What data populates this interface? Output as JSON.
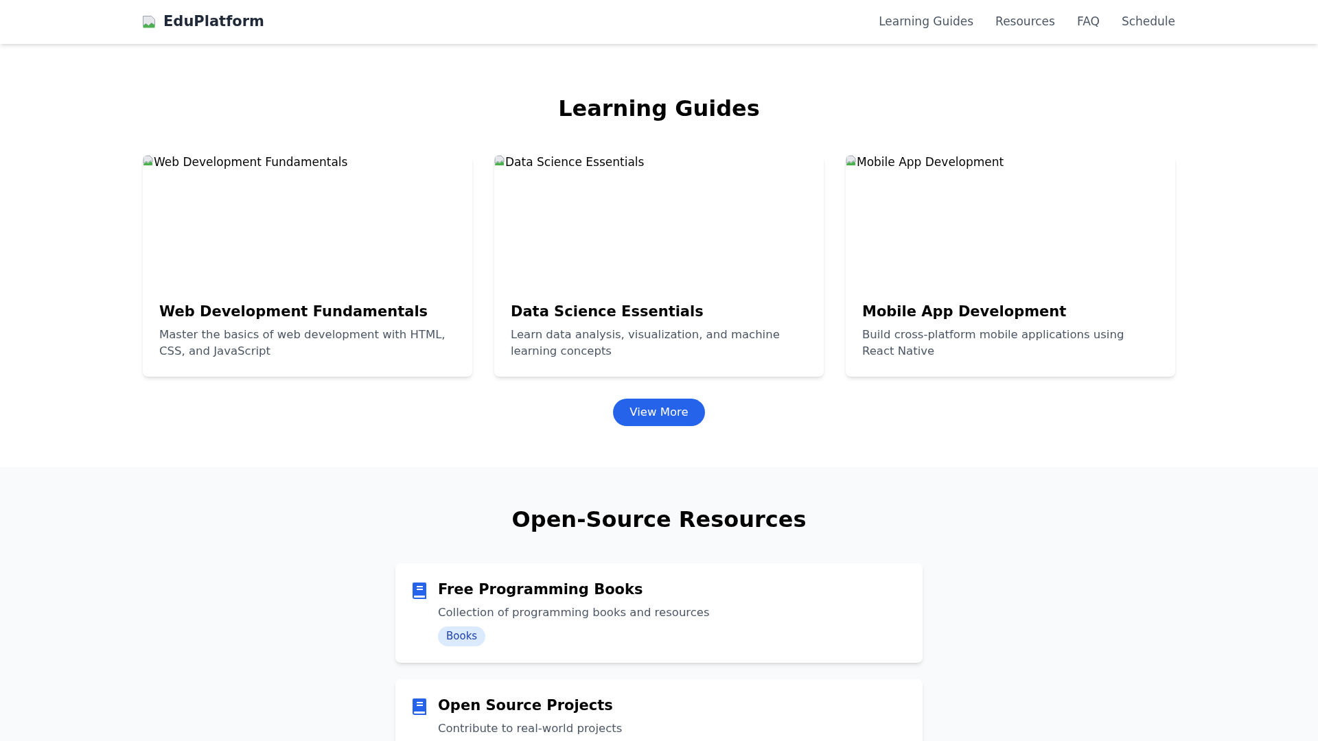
{
  "header": {
    "brand": "EduPlatform",
    "nav": [
      "Learning Guides",
      "Resources",
      "FAQ",
      "Schedule"
    ]
  },
  "guides": {
    "title": "Learning Guides",
    "cards": [
      {
        "image_alt": "Web Development Fundamentals",
        "title": "Web Development Fundamentals",
        "description": "Master the basics of web development with HTML, CSS, and JavaScript"
      },
      {
        "image_alt": "Data Science Essentials",
        "title": "Data Science Essentials",
        "description": "Learn data analysis, visualization, and machine learning concepts"
      },
      {
        "image_alt": "Mobile App Development",
        "title": "Mobile App Development",
        "description": "Build cross-platform mobile applications using React Native"
      }
    ],
    "button": "View More"
  },
  "resources": {
    "title": "Open-Source Resources",
    "items": [
      {
        "title": "Free Programming Books",
        "description": "Collection of programming books and resources",
        "tag": "Books"
      },
      {
        "title": "Open Source Projects",
        "description": "Contribute to real-world projects"
      }
    ]
  }
}
